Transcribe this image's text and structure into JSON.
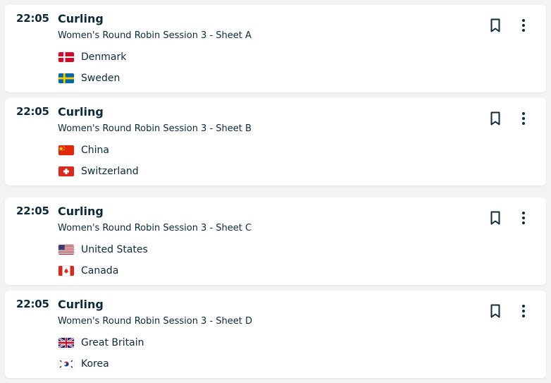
{
  "events": [
    {
      "time": "22:05",
      "sport": "Curling",
      "event": "Women's Round Robin Session 3 - Sheet A",
      "teams": [
        {
          "name": "Denmark",
          "flag": "denmark-flag"
        },
        {
          "name": "Sweden",
          "flag": "sweden-flag"
        }
      ]
    },
    {
      "time": "22:05",
      "sport": "Curling",
      "event": "Women's Round Robin Session 3 - Sheet B",
      "teams": [
        {
          "name": "China",
          "flag": "china-flag"
        },
        {
          "name": "Switzerland",
          "flag": "switzerland-flag"
        }
      ]
    },
    {
      "time": "22:05",
      "sport": "Curling",
      "event": "Women's Round Robin Session 3 - Sheet C",
      "teams": [
        {
          "name": "United States",
          "flag": "usa-flag"
        },
        {
          "name": "Canada",
          "flag": "canada-flag"
        }
      ]
    },
    {
      "time": "22:05",
      "sport": "Curling",
      "event": "Women's Round Robin Session 3 - Sheet D",
      "teams": [
        {
          "name": "Great Britain",
          "flag": "great-britain-flag"
        },
        {
          "name": "Korea",
          "flag": "korea-flag"
        }
      ]
    }
  ],
  "icons": {
    "bookmark": "bookmark-icon",
    "more": "more-vertical-icon"
  },
  "colors": {
    "text": "#0b2a3a",
    "background": "#f2f3f3",
    "card": "#ffffff"
  }
}
